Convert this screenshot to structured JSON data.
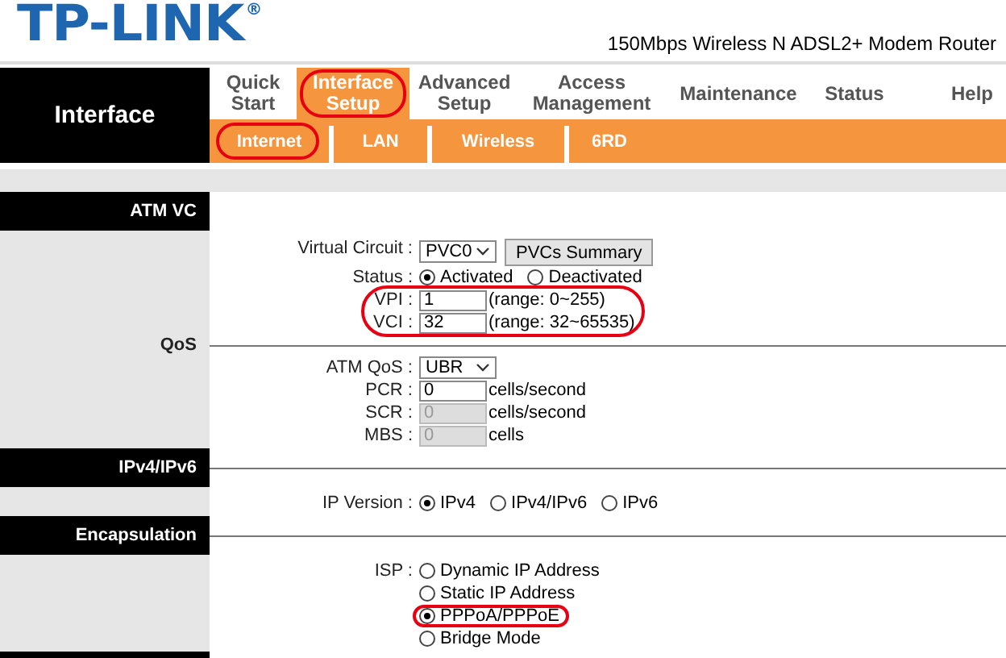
{
  "header": {
    "logo": "TP-LINK",
    "logo_mark": "®",
    "product": "150Mbps Wireless N ADSL2+ Modem Router"
  },
  "nav": {
    "section": "Interface",
    "tabs": [
      {
        "label": "Quick Start",
        "selected": false,
        "circled": false
      },
      {
        "label": "Interface Setup",
        "selected": true,
        "circled": true
      },
      {
        "label": "Advanced Setup",
        "selected": false,
        "circled": false
      },
      {
        "label": "Access Management",
        "selected": false,
        "circled": false
      },
      {
        "label": "Maintenance",
        "selected": false,
        "circled": false
      },
      {
        "label": "Status",
        "selected": false,
        "circled": false
      },
      {
        "label": "Help",
        "selected": false,
        "circled": false
      }
    ],
    "subtabs": [
      {
        "label": "Internet",
        "circled": true
      },
      {
        "label": "LAN",
        "circled": false
      },
      {
        "label": "Wireless",
        "circled": false
      },
      {
        "label": "6RD",
        "circled": false
      }
    ]
  },
  "sections": [
    {
      "kind": "bar",
      "title": "ATM VC",
      "rows": [
        {
          "kind": "select",
          "label": "Virtual Circuit :",
          "value": "PVC0",
          "button": "PVCs Summary",
          "circled": false
        },
        {
          "kind": "radio",
          "label": "Status :",
          "circled": false,
          "options": [
            {
              "label": "Activated",
              "selected": true,
              "circled": false
            },
            {
              "label": "Deactivated",
              "selected": false,
              "circled": false
            }
          ]
        },
        {
          "kind": "input",
          "label": "VPI :",
          "value": "1",
          "hint": "(range: 0~255)",
          "disabled": false,
          "circled": true
        },
        {
          "kind": "input",
          "label": "VCI :",
          "value": "32",
          "hint": "(range: 32~65535)",
          "disabled": false,
          "circled": true
        }
      ]
    },
    {
      "kind": "sub",
      "title": "QoS",
      "rows": [
        {
          "kind": "select",
          "label": "ATM QoS :",
          "value": "UBR",
          "circled": false
        },
        {
          "kind": "input",
          "label": "PCR :",
          "value": "0",
          "hint": "cells/second",
          "disabled": false,
          "circled": false
        },
        {
          "kind": "input",
          "label": "SCR :",
          "value": "0",
          "hint": "cells/second",
          "disabled": true,
          "circled": false
        },
        {
          "kind": "input",
          "label": "MBS :",
          "value": "0",
          "hint": "cells",
          "disabled": true,
          "circled": false
        }
      ]
    },
    {
      "kind": "bar",
      "title": "IPv4/IPv6",
      "rows": [
        {
          "kind": "radio",
          "label": "IP Version :",
          "circled": false,
          "options": [
            {
              "label": "IPv4",
              "selected": true,
              "circled": false
            },
            {
              "label": "IPv4/IPv6",
              "selected": false,
              "circled": false
            },
            {
              "label": "IPv6",
              "selected": false,
              "circled": false
            }
          ]
        }
      ]
    },
    {
      "kind": "bar",
      "title": "Encapsulation",
      "rows": [
        {
          "kind": "radio_list",
          "label": "ISP :",
          "circled": false,
          "options": [
            {
              "label": "Dynamic IP Address",
              "selected": false,
              "circled": false
            },
            {
              "label": "Static IP Address",
              "selected": false,
              "circled": false
            },
            {
              "label": "PPPoA/PPPoE",
              "selected": true,
              "circled": true
            },
            {
              "label": "Bridge Mode",
              "selected": false,
              "circled": false
            }
          ]
        }
      ]
    }
  ]
}
